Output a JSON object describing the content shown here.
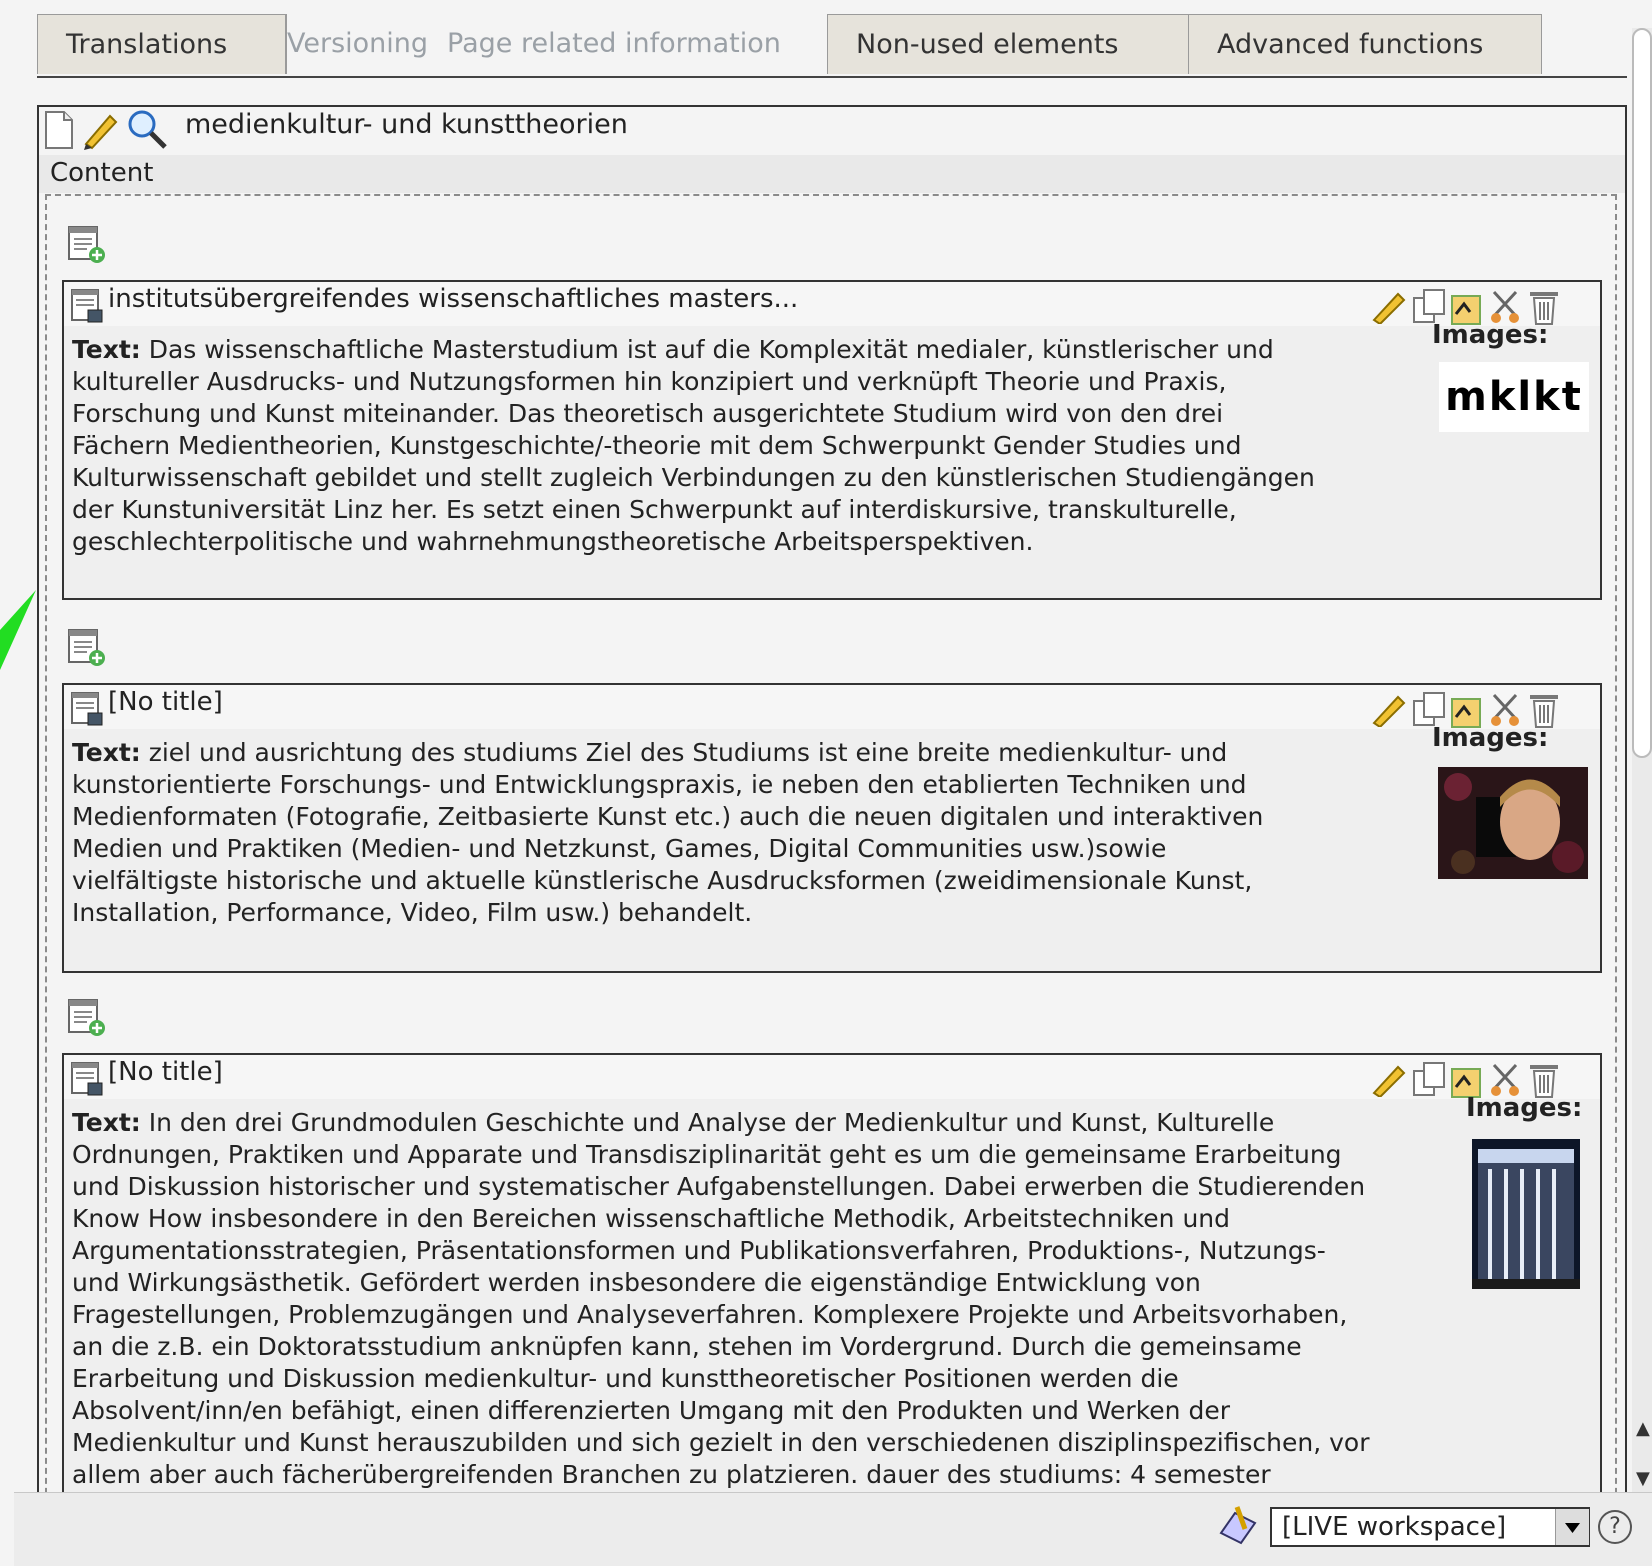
{
  "tabs": [
    {
      "label": "Translations",
      "active": false
    },
    {
      "label": "Versioning",
      "active": false,
      "dimmed": true
    },
    {
      "label": "Page related information",
      "active": false,
      "dimmed": true
    },
    {
      "label": "Non-used elements",
      "active": false
    },
    {
      "label": "Advanced functions",
      "active": false
    }
  ],
  "page": {
    "title": "medienkultur- und kunsttheorien",
    "column_label": "Content"
  },
  "elements": [
    {
      "title": "institutsübergreifendes wissenschaftliches masters...",
      "text_label": "Text:",
      "text": " Das wissenschaftliche Masterstudium ist auf die Komplexität medialer, künstlerischer und\nkultureller Ausdrucks- und Nutzungsformen hin konzipiert und verknüpft Theorie und Praxis,\nForschung und Kunst miteinander. Das theoretisch ausgerichtete Studium wird von den drei\nFächern Medientheorien, Kunstgeschichte/-theorie mit dem Schwerpunkt Gender Studies und\nKulturwissenschaft gebildet und stellt zugleich Verbindungen zu den künstlerischen Studiengängen\nder Kunstuniversität Linz her. Es setzt einen Schwerpunkt auf interdiskursive, transkulturelle,\ngeschlechterpolitische und wahrnehmungstheoretische Arbeitsperspektiven.",
      "images_label": "Images:",
      "image_logo": "mklkt"
    },
    {
      "title": "[No title]",
      "text_label": "Text:",
      "text": " ziel und ausrichtung des studiums Ziel des Studiums ist eine breite medienkultur- und\nkunstorientierte Forschungs- und Entwicklungspraxis, ie neben den etablierten Techniken und\nMedienformaten (Fotografie, Zeitbasierte Kunst etc.) auch die neuen digitalen und interaktiven\nMedien und Praktiken (Medien- und Netzkunst, Games, Digital Communities usw.)sowie\nvielfältigste historische und aktuelle künstlerische Ausdrucksformen (zweidimensionale Kunst,\nInstallation, Performance, Video, Film usw.) behandelt.",
      "images_label": "Images:"
    },
    {
      "title": "[No title]",
      "text_label": "Text:",
      "text": " In den drei Grundmodulen Geschichte und Analyse der Medienkultur und Kunst, Kulturelle\nOrdnungen, Praktiken und Apparate und Transdisziplinarität geht es um die gemeinsame Erarbeitung\nund Diskussion historischer und systematischer Aufgabenstellungen. Dabei erwerben die Studierenden\nKnow How insbesondere in den Bereichen wissenschaftliche Methodik, Arbeitstechniken und\nArgumentationsstrategien, Präsentationsformen und Publikationsverfahren, Produktions-, Nutzungs-\nund Wirkungsästhetik. Gefördert werden insbesondere die eigenständige Entwicklung von\nFragestellungen, Problemzugängen und Analyseverfahren. Komplexere Projekte und Arbeitsvorhaben,\nan die z.B. ein Doktoratsstudium anknüpfen kann, stehen im Vordergrund. Durch die gemeinsame\nErarbeitung und Diskussion medienkultur- und kunsttheoretischer Positionen werden die\nAbsolvent/inn/en befähigt, einen differenzierten Umgang mit den Produkten und Werken der\nMedienkultur und Kunst herauszubilden und sich gezielt in den verschiedenen disziplinspezifischen, vor\nallem aber auch fächerübergreifenden Branchen zu platzieren. dauer des studiums: 4 semester",
      "images_label": "Images:"
    }
  ],
  "footer": {
    "workspace": "[LIVE workspace]",
    "help": "?"
  },
  "colors": {
    "accent_green": "#22dd22",
    "border": "#333333"
  }
}
